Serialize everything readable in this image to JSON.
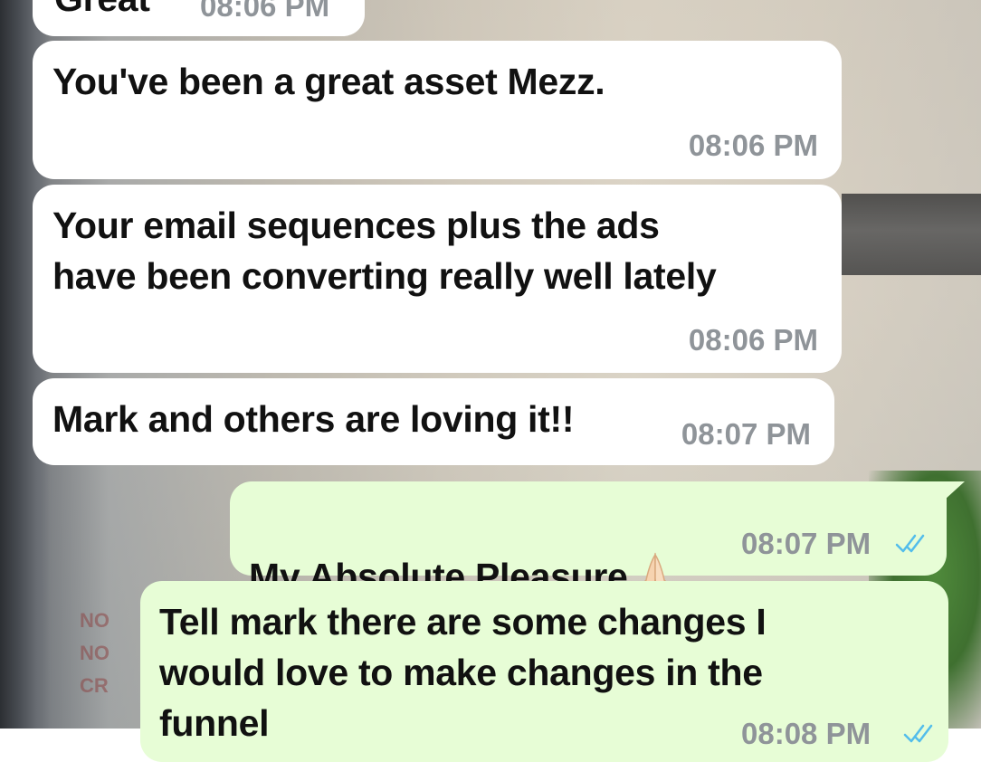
{
  "messages": [
    {
      "direction": "incoming",
      "text": "You've been a great asset Mezz.",
      "time": "08:06 PM"
    },
    {
      "direction": "incoming",
      "text": "Your email sequences plus the ads\nhave been converting really well lately",
      "time": "08:06 PM"
    },
    {
      "direction": "incoming",
      "text": "Mark and others are loving it!!",
      "time": "08:07 PM"
    },
    {
      "direction": "outgoing",
      "text": "My Absolute Pleasure",
      "emoji": "folded-hands-emoji",
      "time": "08:07 PM",
      "status": "read"
    },
    {
      "direction": "outgoing",
      "text": "Tell mark there are some changes I\nwould love to make changes in the\nfunnel",
      "time": "08:08 PM",
      "status": "read"
    }
  ],
  "partial_top": {
    "text": "Great",
    "time": "08:06 PM"
  },
  "wallpaper_text": "NO\nNO\nCR",
  "colors": {
    "incoming_bubble": "#ffffff",
    "outgoing_bubble": "#e7fdd6",
    "timestamp": "#8f9499",
    "read_ticks": "#53bdeb"
  }
}
